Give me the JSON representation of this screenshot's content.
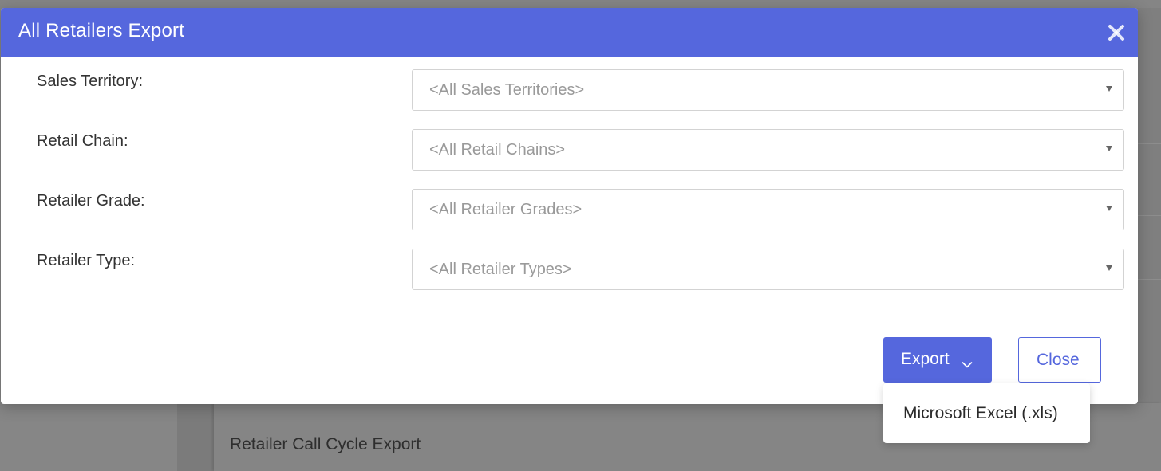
{
  "background": {
    "card_item_label": "Retailer Call Cycle Export"
  },
  "modal": {
    "title": "All Retailers Export",
    "close_icon": "close-icon",
    "fields": [
      {
        "label": "Sales Territory:",
        "value": "<All Sales Territories>"
      },
      {
        "label": "Retail Chain:",
        "value": "<All Retail Chains>"
      },
      {
        "label": "Retailer Grade:",
        "value": "<All Retailer Grades>"
      },
      {
        "label": "Retailer Type:",
        "value": "<All Retailer Types>"
      }
    ],
    "export_button_label": "Export",
    "close_button_label": "Close",
    "export_menu": {
      "items": [
        "Microsoft Excel (.xls)"
      ]
    }
  },
  "colors": {
    "header": "#5567dd",
    "accent": "#5567dd",
    "overlay": "#7b7b7b"
  }
}
